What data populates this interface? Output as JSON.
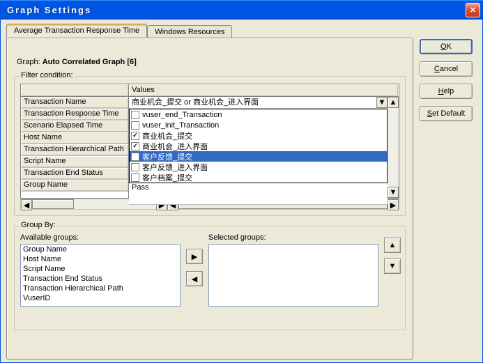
{
  "window": {
    "title": "Graph Settings"
  },
  "buttons": {
    "ok": "OK",
    "cancel": "Cancel",
    "help": "Help",
    "setdefault": "Set Default"
  },
  "tabs": {
    "active": "Average Transaction Response Time",
    "other": "Windows Resources"
  },
  "graph": {
    "label": "Graph:",
    "name": "Auto Correlated Graph [6]"
  },
  "filter": {
    "legend": "Filter condition:",
    "values_header": "Values",
    "rows": [
      "Transaction Name",
      "Transaction Response Time",
      "Scenario Elapsed Time",
      "Host Name",
      "Transaction Hierarchical Path",
      "Script Name",
      "Transaction End Status",
      "Group Name"
    ],
    "combo_value": "商业机会_提交 or 商业机会_进入界面",
    "dropdown": [
      {
        "label": "vuser_end_Transaction",
        "checked": false
      },
      {
        "label": "vuser_init_Transaction",
        "checked": false
      },
      {
        "label": "商业机会_提交",
        "checked": true
      },
      {
        "label": "商业机会_进入界面",
        "checked": true
      },
      {
        "label": "客户反馈_提交",
        "checked": false,
        "selected": true
      },
      {
        "label": "客户反馈_进入界面",
        "checked": false
      },
      {
        "label": "客户档案_提交",
        "checked": false
      }
    ],
    "below_text": "Pass"
  },
  "groupby": {
    "legend": "Group By:",
    "avail_label": "Available groups:",
    "sel_label": "Selected groups:",
    "avail": [
      "Group Name",
      "Host Name",
      "Script Name",
      "Transaction End Status",
      "Transaction Hierarchical Path",
      "VuserID"
    ]
  }
}
